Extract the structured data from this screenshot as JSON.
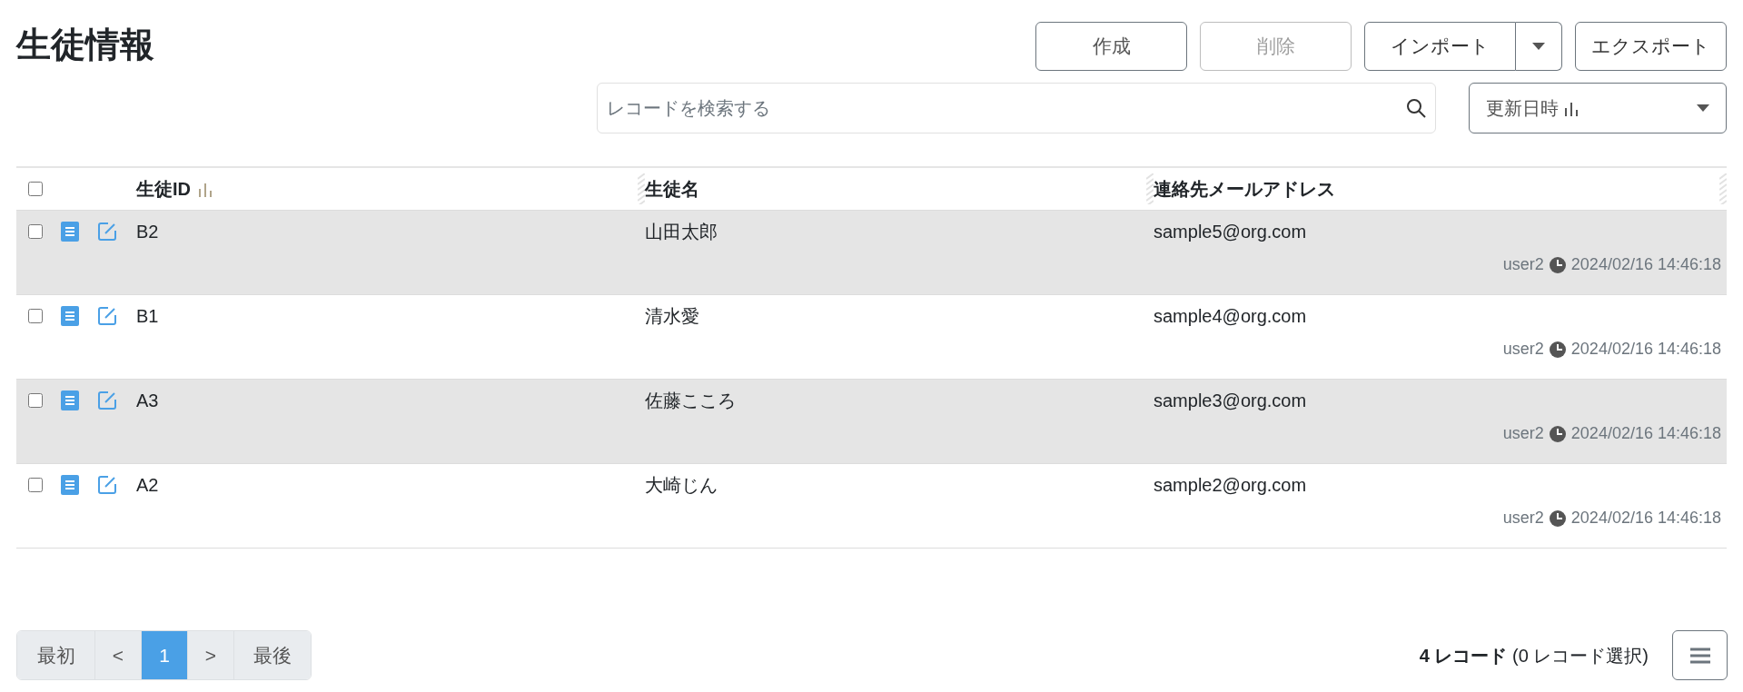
{
  "title": "生徒情報",
  "actions": [
    {
      "label": "作成",
      "disabled": false
    },
    {
      "label": "削除",
      "disabled": true
    }
  ],
  "import_button": {
    "label": "インポート"
  },
  "export_button": {
    "label": "エクスポート"
  },
  "search": {
    "placeholder": "レコードを検索する"
  },
  "sort_select": {
    "value": "更新日時"
  },
  "table": {
    "select_all_checked": false,
    "columns": [
      {
        "label": "生徒ID",
        "sorted": true
      },
      {
        "label": "生徒名",
        "sorted": false
      },
      {
        "label": "連絡先メールアドレス",
        "sorted": false
      }
    ],
    "rows": [
      {
        "checked": false,
        "cells": [
          "B2",
          "山田太郎",
          "sample5@org.com"
        ],
        "user": "user2",
        "updated": "2024/02/16 14:46:18"
      },
      {
        "checked": false,
        "cells": [
          "B1",
          "清水愛",
          "sample4@org.com"
        ],
        "user": "user2",
        "updated": "2024/02/16 14:46:18"
      },
      {
        "checked": false,
        "cells": [
          "A3",
          "佐藤こころ",
          "sample3@org.com"
        ],
        "user": "user2",
        "updated": "2024/02/16 14:46:18"
      },
      {
        "checked": false,
        "cells": [
          "A2",
          "大崎じん",
          "sample2@org.com"
        ],
        "user": "user2",
        "updated": "2024/02/16 14:46:18"
      }
    ]
  },
  "pagination": [
    {
      "label": "最初",
      "selected": false
    },
    {
      "label": "<",
      "selected": false
    },
    {
      "label": "1",
      "selected": true
    },
    {
      "label": ">",
      "selected": false
    },
    {
      "label": "最後",
      "selected": false
    }
  ],
  "record_count": "**4 レコード** (0 レコード選択)"
}
